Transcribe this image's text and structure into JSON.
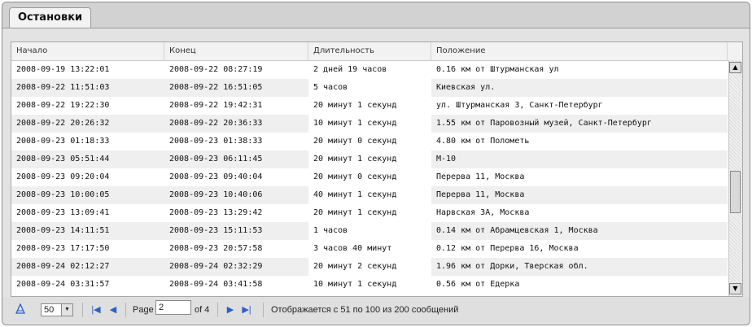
{
  "tab": {
    "label": "Остановки"
  },
  "columns": [
    "Начало",
    "Конец",
    "Длительность",
    "Положение"
  ],
  "rows": [
    [
      "2008-09-19 13:22:01",
      "2008-09-22 08:27:19",
      "2 дней 19 часов",
      "0.16 км от Штурманская ул"
    ],
    [
      "2008-09-22 11:51:03",
      "2008-09-22 16:51:05",
      "5 часов",
      "Киевская ул."
    ],
    [
      "2008-09-22 19:22:30",
      "2008-09-22 19:42:31",
      "20 минут 1 секунд",
      "ул. Штурманская 3, Санкт-Петербург"
    ],
    [
      "2008-09-22 20:26:32",
      "2008-09-22 20:36:33",
      "10 минут 1 секунд",
      "1.55 км от Паровозный музей, Санкт-Петербург"
    ],
    [
      "2008-09-23 01:18:33",
      "2008-09-23 01:38:33",
      "20 минут 0 секунд",
      "4.80 км от Пoлометь"
    ],
    [
      "2008-09-23 05:51:44",
      "2008-09-23 06:11:45",
      "20 минут 1 секунд",
      "М-10"
    ],
    [
      "2008-09-23 09:20:04",
      "2008-09-23 09:40:04",
      "20 минут 0 секунд",
      "Перерва 11, Москва"
    ],
    [
      "2008-09-23 10:00:05",
      "2008-09-23 10:40:06",
      "40 минут 1 секунд",
      "Перерва 11, Москва"
    ],
    [
      "2008-09-23 13:09:41",
      "2008-09-23 13:29:42",
      "20 минут 1 секунд",
      "Нарвская 3А, Москва"
    ],
    [
      "2008-09-23 14:11:51",
      "2008-09-23 15:11:53",
      "1 часов",
      "0.14 км от Абрамцевская 1, Москва"
    ],
    [
      "2008-09-23 17:17:50",
      "2008-09-23 20:57:58",
      "3 часов 40 минут",
      "0.12 км от Перерва 16, Москва"
    ],
    [
      "2008-09-24 02:12:27",
      "2008-09-24 02:32:29",
      "20 минут 2 секунд",
      "1.96 км от Дорки, Тверская обл."
    ],
    [
      "2008-09-24 03:31:57",
      "2008-09-24 03:41:58",
      "10 минут 1 секунд",
      "0.56 км от Едерка"
    ]
  ],
  "pager": {
    "page_size": "50",
    "page_label": "Page",
    "page_value": "2",
    "of_label": "of 4",
    "status": "Отображается с 51 по 100 из 200 сообщений"
  },
  "scrollbar": {
    "up": "▲",
    "down": "▼"
  },
  "colors": {
    "nav_icon": "#2a5fc9",
    "alt_row": "#efefef"
  }
}
